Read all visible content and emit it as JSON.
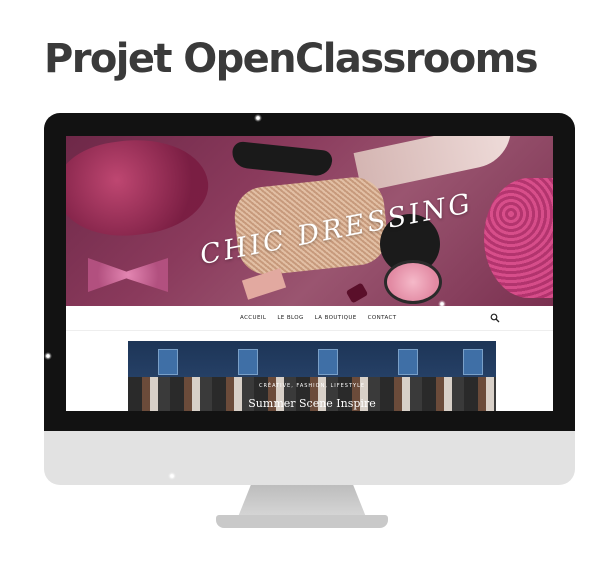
{
  "page_title": "Projet OpenClassrooms",
  "site": {
    "brand": "CHIC DRESSING",
    "nav_items": [
      "ACCUEIL",
      "LE BLOG",
      "LA BOUTIQUE",
      "CONTACT"
    ],
    "banner_eyebrow": "CRÉATIVE, FASHION, LIFESTYLE",
    "banner_title": "Summer Scene Inspire"
  },
  "colors": {
    "title_text": "#3a3a3a",
    "bezel": "#121212",
    "chin": "#e2e2e2",
    "hero_tint": "#8a3a5c",
    "banner_bg": "#1d3557"
  },
  "icons": {
    "search": "search-icon"
  }
}
